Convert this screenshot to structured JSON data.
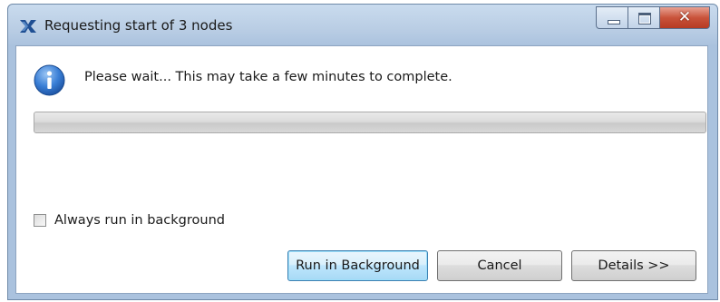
{
  "window": {
    "title": "Requesting start of 3 nodes",
    "app_icon": "eclipse-x-icon",
    "controls": {
      "minimize_icon": "minimize-icon",
      "maximize_icon": "maximize-icon",
      "close_glyph": "✕"
    }
  },
  "dialog": {
    "info_icon": "info-icon",
    "message": "Please wait...  This may take a few minutes to complete.",
    "progress": {
      "value_fraction": 0
    },
    "checkbox": {
      "label": "Always run in background",
      "checked": false
    },
    "buttons": {
      "run_in_background": "Run in Background",
      "cancel": "Cancel",
      "details": "Details >>"
    }
  },
  "colors": {
    "title_bar": "#b9cde4",
    "close_button": "#c9533b",
    "info_icon": "#2f6fc1",
    "default_button_border": "#3c7fb1"
  }
}
